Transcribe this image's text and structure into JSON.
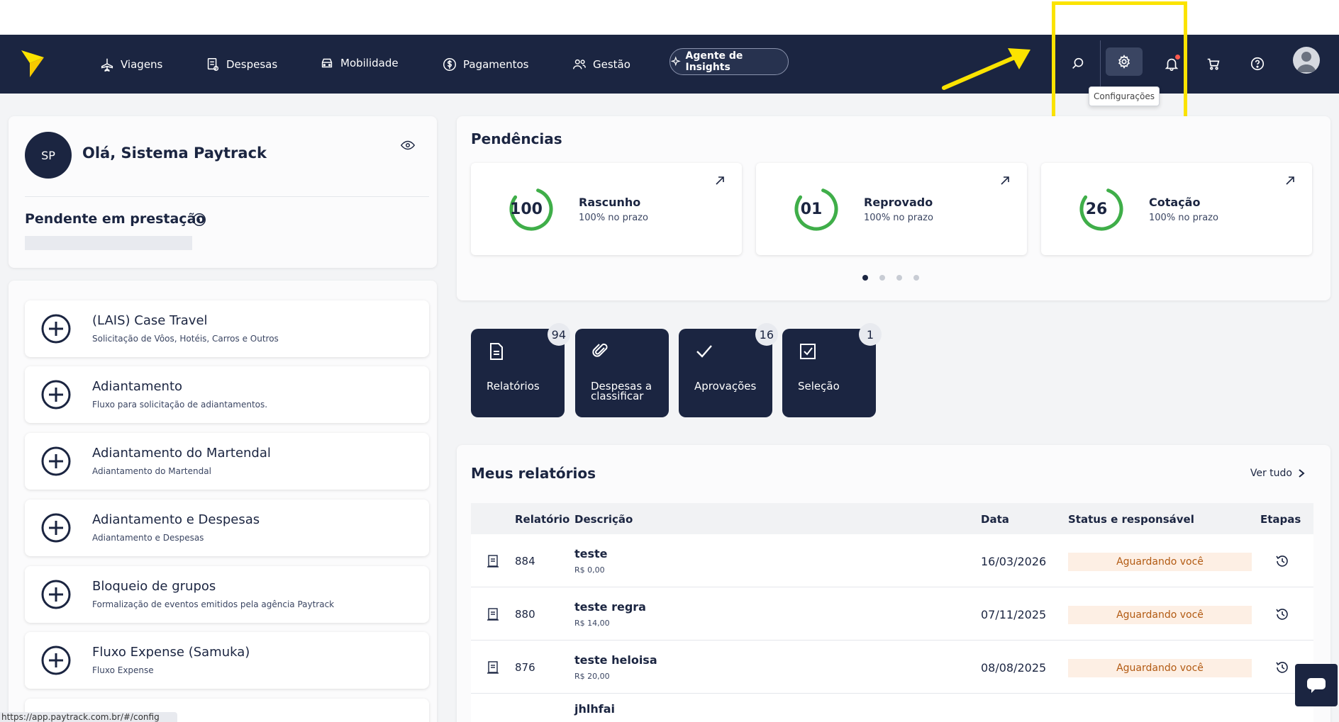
{
  "nav": {
    "items": [
      {
        "label": "Viagens",
        "icon": "plane-icon"
      },
      {
        "label": "Despesas",
        "icon": "receipt-icon"
      },
      {
        "label": "Mobilidade",
        "icon": "car-icon"
      },
      {
        "label": "Pagamentos",
        "icon": "dollar-icon"
      },
      {
        "label": "Gestão",
        "icon": "users-icon"
      }
    ],
    "insights_label": "Agente de Insights",
    "tooltip": "Configurações"
  },
  "greeting": {
    "initials": "SP",
    "title": "Olá, Sistema Paytrack",
    "pending_label": "Pendente em prestação"
  },
  "flows": [
    {
      "title": "(LAIS) Case Travel",
      "subtitle": "Solicitação de Vôos, Hotéis, Carros e Outros"
    },
    {
      "title": "Adiantamento",
      "subtitle": "Fluxo para solicitação de adiantamentos."
    },
    {
      "title": "Adiantamento do Martendal",
      "subtitle": "Adiantamento do Martendal"
    },
    {
      "title": "Adiantamento e Despesas",
      "subtitle": "Adiantamento e Despesas"
    },
    {
      "title": "Bloqueio de grupos",
      "subtitle": "Formalização de eventos emitidos pela agência Paytrack"
    },
    {
      "title": "Fluxo Expense (Samuka)",
      "subtitle": "Fluxo Expense"
    }
  ],
  "pendencias": {
    "title": "Pendências",
    "items": [
      {
        "num": "100",
        "label": "Rascunho",
        "sub": "100% no prazo",
        "pct": 100
      },
      {
        "num": "01",
        "label": "Reprovado",
        "sub": "100% no prazo",
        "pct": 100
      },
      {
        "num": "26",
        "label": "Cotação",
        "sub": "100% no prazo",
        "pct": 100
      }
    ]
  },
  "tiles": [
    {
      "label": "Relatórios",
      "badge": "94",
      "icon": "document-icon"
    },
    {
      "label": "Despesas a classificar",
      "badge": "",
      "icon": "paperclip-icon"
    },
    {
      "label": "Aprovações",
      "badge": "16",
      "icon": "check-icon"
    },
    {
      "label": "Seleção",
      "badge": "1",
      "icon": "checkbox-icon"
    }
  ],
  "relatorios": {
    "title": "Meus relatórios",
    "see_all": "Ver tudo",
    "headers": {
      "relatorio": "Relatório",
      "descricao": "Descrição",
      "data": "Data",
      "status": "Status e responsável",
      "etapas": "Etapas"
    },
    "rows": [
      {
        "id": "884",
        "desc": "teste",
        "value": "R$ 0,00",
        "date": "16/03/2026",
        "status": "Aguardando você"
      },
      {
        "id": "880",
        "desc": "teste regra",
        "value": "R$ 14,00",
        "date": "07/11/2025",
        "status": "Aguardando você"
      },
      {
        "id": "876",
        "desc": "teste heloisa",
        "value": "R$ 20,00",
        "date": "08/08/2025",
        "status": "Aguardando você"
      },
      {
        "id": "",
        "desc": "jhlhfai",
        "value": "",
        "date": "",
        "status": ""
      }
    ]
  },
  "status_url": "https://app.paytrack.com.br/#/config",
  "colors": {
    "navy": "#1b2541",
    "highlight": "#fbe300",
    "ring": "#3fae49",
    "status_bg": "#fdefe4",
    "status_text": "#b25a12"
  }
}
